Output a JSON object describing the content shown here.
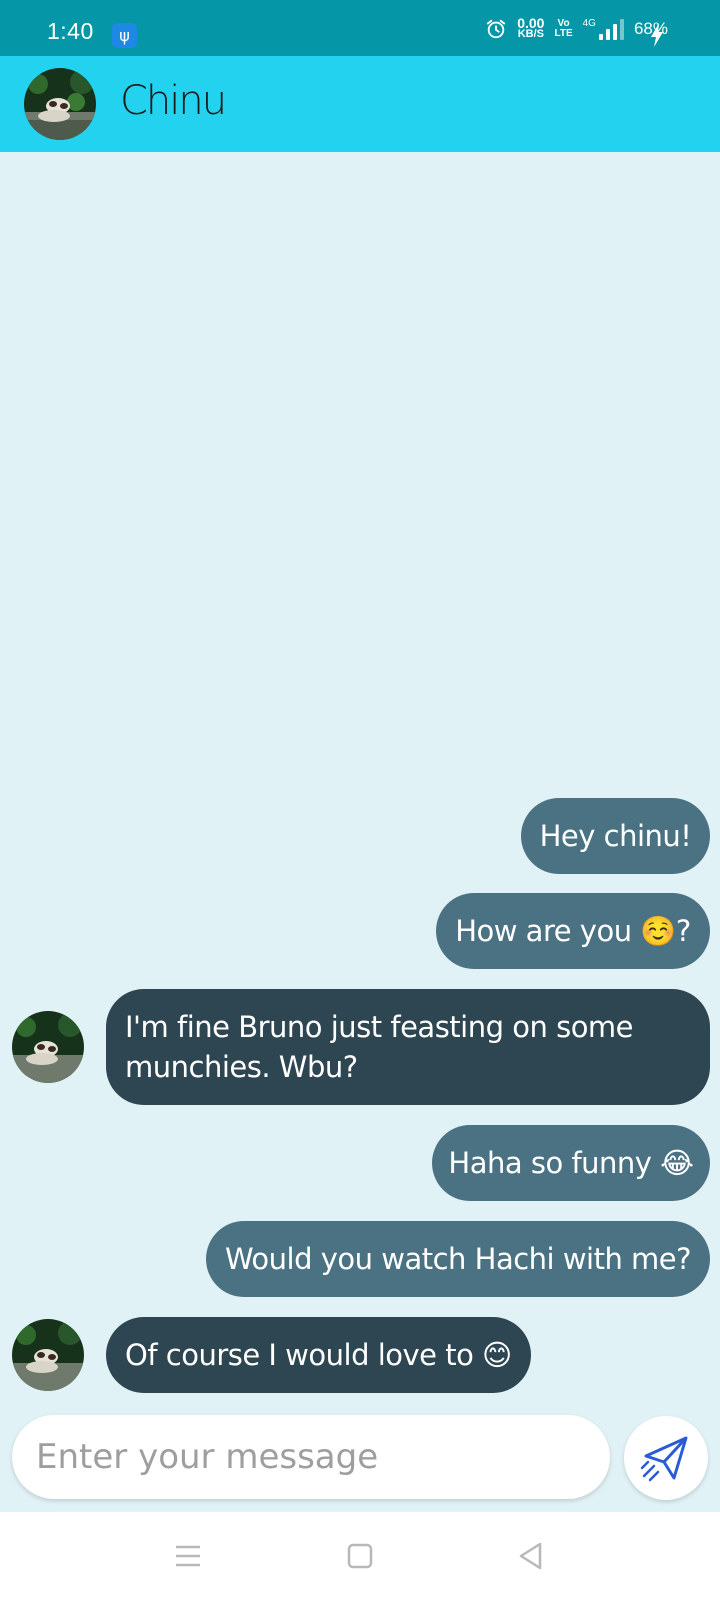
{
  "status_bar": {
    "time": "1:40",
    "usb_icon": "usb-icon",
    "net_speed_value": "0.00",
    "net_speed_unit": "KB/S",
    "volte_top": "Vo",
    "volte_bottom": "LTE",
    "network_type": "4G",
    "battery": "68%",
    "charging_icon": "bolt-icon"
  },
  "header": {
    "contact_name": "Chinu",
    "avatar_icon": "dog-avatar"
  },
  "messages": [
    {
      "sender": "me",
      "text": "Hey chinu!"
    },
    {
      "sender": "me",
      "text": "How are you ☺️?"
    },
    {
      "sender": "Chinu",
      "text": "I'm fine Bruno just feasting on some munchies. Wbu?"
    },
    {
      "sender": "me",
      "text": "Haha so funny 😂"
    },
    {
      "sender": "me",
      "text": "Would you watch Hachi with me?"
    },
    {
      "sender": "Chinu",
      "text": "Of course I would love to 😊"
    }
  ],
  "composer": {
    "placeholder": "Enter your message",
    "value": "",
    "send_icon": "paper-plane-icon"
  },
  "nav_bar": {
    "icons": [
      "menu-icon",
      "home-icon",
      "back-icon"
    ]
  },
  "colors": {
    "status_bar": "#0597a8",
    "header": "#22d2ee",
    "background": "#e0f2f5",
    "sent_bubble": "#4b7283",
    "received_bubble": "#2d4651",
    "send_icon": "#2a5bd7"
  }
}
